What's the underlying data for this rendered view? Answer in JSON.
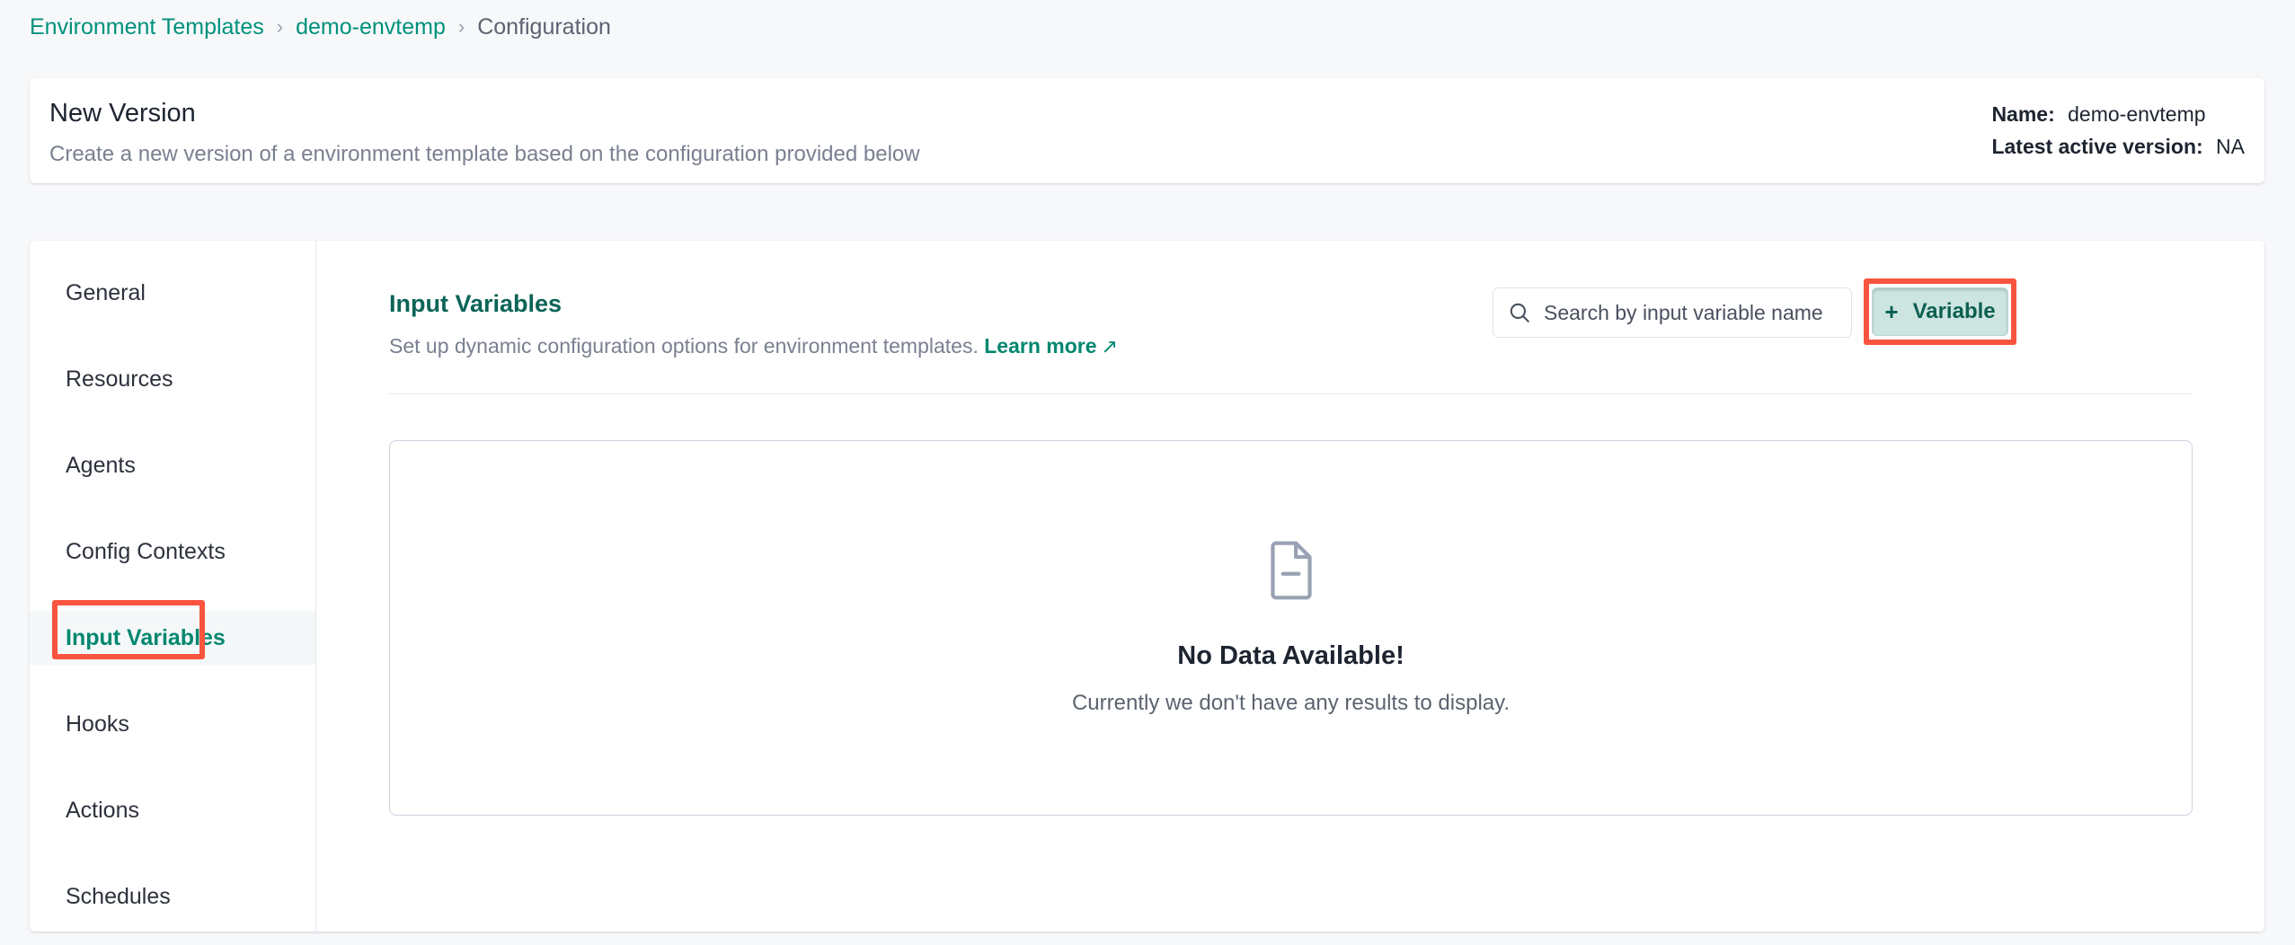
{
  "breadcrumb": {
    "items": [
      {
        "label": "Environment Templates",
        "type": "link"
      },
      {
        "label": "demo-envtemp",
        "type": "link"
      },
      {
        "label": "Configuration",
        "type": "current"
      }
    ],
    "separator": "›"
  },
  "header": {
    "title": "New Version",
    "subtitle": "Create a new version of a environment template based on the configuration provided below",
    "meta": {
      "name_label": "Name:",
      "name_value": "demo-envtemp",
      "version_label": "Latest active version:",
      "version_value": "NA"
    }
  },
  "sidebar": {
    "items": [
      {
        "label": "General",
        "active": false
      },
      {
        "label": "Resources",
        "active": false
      },
      {
        "label": "Agents",
        "active": false
      },
      {
        "label": "Config Contexts",
        "active": false
      },
      {
        "label": "Input Variables",
        "active": true
      },
      {
        "label": "Hooks",
        "active": false
      },
      {
        "label": "Actions",
        "active": false
      },
      {
        "label": "Schedules",
        "active": false
      }
    ]
  },
  "content": {
    "title": "Input Variables",
    "description": "Set up dynamic configuration options for environment templates.",
    "learn_more_label": "Learn more",
    "learn_more_icon": "external-link-arrow-icon"
  },
  "search": {
    "placeholder": "Search by input variable name",
    "value": "",
    "icon": "search-icon"
  },
  "toolbar": {
    "add_variable_plus": "+",
    "add_variable_label": "Variable"
  },
  "empty_state": {
    "icon": "document-minus-icon",
    "title": "No Data Available!",
    "message": "Currently we don't have any results to display."
  },
  "colors": {
    "accent_teal": "#00a189",
    "accent_teal_dark": "#0b6456",
    "annotation_red": "#f9543f",
    "button_fill": "#cde5e0",
    "page_background": "#f7f8fa",
    "card_background": "#ffffff",
    "border_gray": "#e4e7ec",
    "muted_text": "#7a8090"
  }
}
